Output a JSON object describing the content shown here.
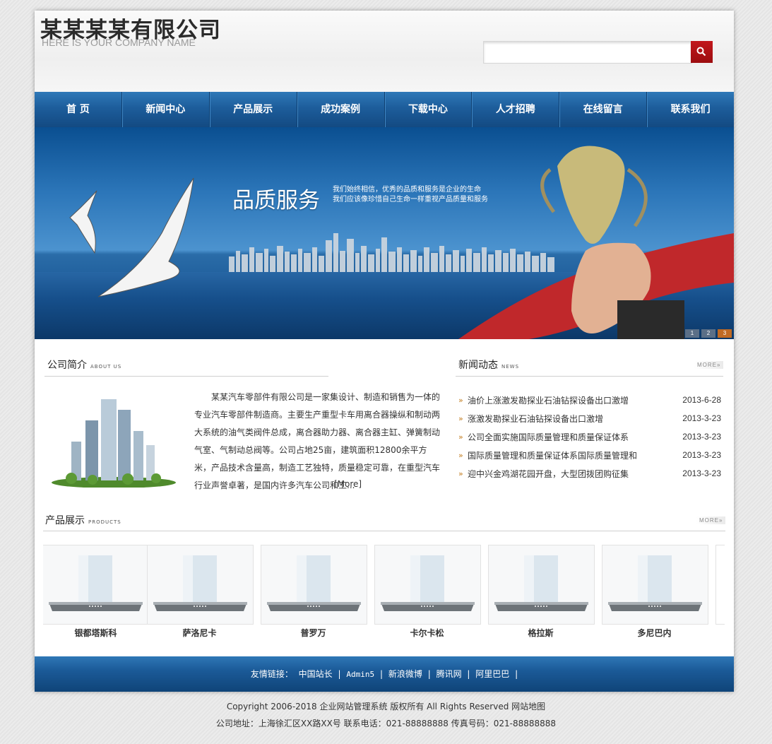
{
  "header": {
    "logo_cn": "某某某某有限公司",
    "logo_en": "HERE IS YOUR COMPANY NAME",
    "search_placeholder": "",
    "search_icon": "search-icon"
  },
  "nav": {
    "items": [
      "首 页",
      "新闻中心",
      "产品展示",
      "成功案例",
      "下载中心",
      "人才招聘",
      "在线留言",
      "联系我们"
    ]
  },
  "banner": {
    "title": "品质服务",
    "sub1": "我们始终相信，优秀的品质和服务是企业的生命",
    "sub2": "我们应该像珍惜自己生命一样重视产品质量和服务",
    "dots": [
      "1",
      "2",
      "3"
    ],
    "active_dot": 3
  },
  "about": {
    "title": "公司简介",
    "title_en": "ABOUT US",
    "text": "某某汽车零部件有限公司是一家集设计、制造和销售为一体的专业汽车零部件制造商。主要生产重型卡车用离合器操纵和制动两大系统的油气类阀件总成，离合器助力器、离合器主缸、弹簧制动气室、气制动总阀等。公司占地25亩，建筑面积12800余平方米，产品技术含量高，制造工艺独特，质量稳定可靠，在重型汽车行业声誉卓著，是国内许多汽车公司和工...",
    "more": "[More]"
  },
  "news": {
    "title": "新闻动态",
    "title_en": "NEWS",
    "more": "MORE»",
    "items": [
      {
        "title": "油价上涨激发勘探业石油钻探设备出口激增",
        "date": "2013-6-28"
      },
      {
        "title": "涨激发勘探业石油钻探设备出口激增",
        "date": "2013-3-23"
      },
      {
        "title": "公司全面实施国际质量管理和质量保证体系",
        "date": "2013-3-23"
      },
      {
        "title": "国际质量管理和质量保证体系国际质量管理和",
        "date": "2013-3-23"
      },
      {
        "title": "迎中兴金鸡湖花园开盘，大型团拨团购征集",
        "date": "2013-3-23"
      }
    ]
  },
  "products": {
    "title": "产品展示",
    "title_en": "PRODUCTS",
    "more": "MORE»",
    "items": [
      "银都塔斯科",
      "萨洛尼卡",
      "普罗万",
      "卡尔卡松",
      "格拉斯",
      "多尼巴内"
    ]
  },
  "footer": {
    "links_label": "友情链接：",
    "links": [
      "中国站长",
      "Admin5",
      "新浪微博",
      "腾讯网",
      "阿里巴巴"
    ],
    "separator": "|",
    "copyright": "Copyright 2006-2018 企业网站管理系统 版权所有 All Rights Reserved  网站地图",
    "address": "公司地址：上海徐汇区XX路XX号  联系电话：021-88888888  传真号码：021-88888888"
  },
  "colors": {
    "nav_blue": "#1d5d9b",
    "search_red": "#b01418",
    "bullet_orange": "#c17a1a"
  }
}
